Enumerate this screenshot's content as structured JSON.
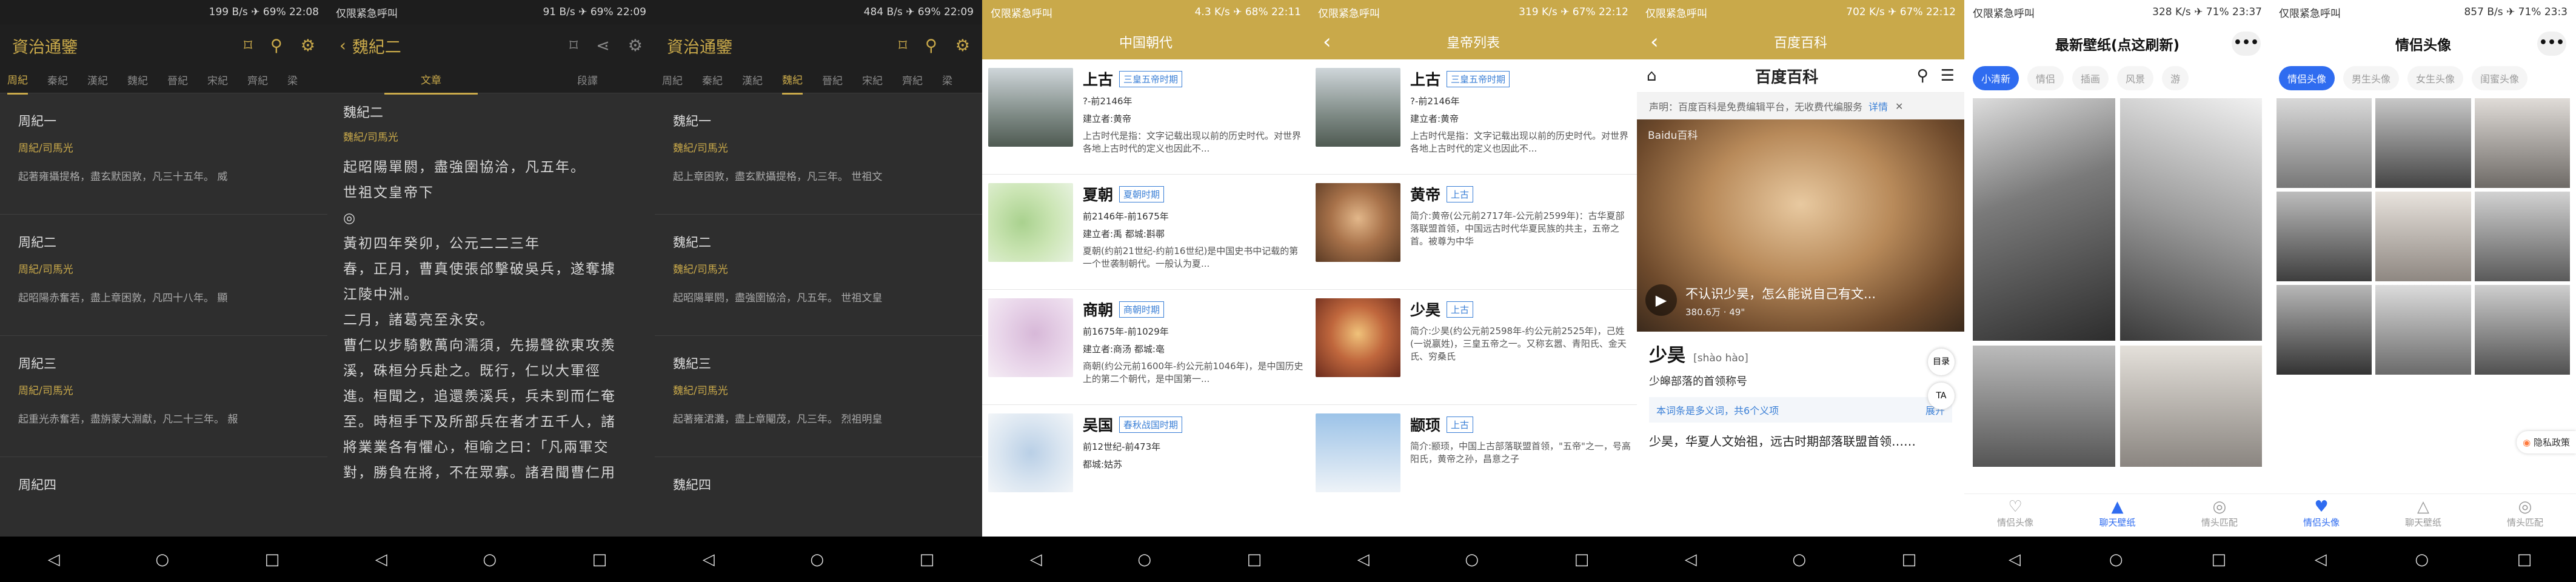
{
  "status": {
    "s1": {
      "left": "",
      "right": "199 B/s ✈ 69% 22:08"
    },
    "s2": {
      "left": "仅限紧急呼叫",
      "right": "91 B/s ✈ 69% 22:09"
    },
    "s3": {
      "left": "",
      "right": "484 B/s ✈ 69% 22:09"
    },
    "s4": {
      "left": "仅限紧急呼叫",
      "right": "4.3 K/s ✈ 68% 22:11"
    },
    "s5": {
      "left": "仅限紧急呼叫",
      "right": "319 K/s ✈ 67% 22:12"
    },
    "s6": {
      "left": "仅限紧急呼叫",
      "right": "702 K/s ✈ 67% 22:12"
    },
    "s7": {
      "left": "仅限紧急呼叫",
      "right": "328 K/s ✈ 71% 23:37"
    },
    "s8": {
      "left": "仅限紧急呼叫",
      "right": "857 B/s ✈ 71% 23:3"
    }
  },
  "reader1": {
    "title": "資治通鑒",
    "tabs": [
      "周紀",
      "秦紀",
      "漢紀",
      "魏紀",
      "晉紀",
      "宋紀",
      "齊紀",
      "梁"
    ],
    "items": [
      {
        "title": "周紀一",
        "author": "周紀/司馬光",
        "summary": "起著雍攝提格，盡玄默困敦，凡三十五年。 威"
      },
      {
        "title": "周紀二",
        "author": "周紀/司馬光",
        "summary": "起昭陽赤奮若，盡上章困敦，凡四十八年。 顯"
      },
      {
        "title": "周紀三",
        "author": "周紀/司馬光",
        "summary": "起重光赤奮若，盡旃蒙大淵獻，凡二十三年。 赧"
      },
      {
        "title": "周紀四",
        "author": "",
        "summary": ""
      }
    ]
  },
  "reader2": {
    "title": "魏紀二",
    "tabs": [
      "文章",
      "段譯"
    ],
    "head": "魏紀二",
    "author": "魏紀/司馬光",
    "lines": [
      "起昭陽單閼，盡強圉協洽，凡五年。",
      "世祖文皇帝下",
      "◎",
      "黃初四年癸卯，公元二二三年",
      "春，正月，曹真使張郃擊破吳兵，遂奪據",
      "江陵中洲。",
      "二月，諸葛亮至永安。",
      "曹仁以步騎數萬向濡須，先揚聲欲東攻羨",
      "溪，硃桓分兵赴之。既行，仁以大軍徑",
      "進。桓聞之，追還羨溪兵，兵未到而仁奄",
      "至。時桓手下及所部兵在者才五千人，諸",
      "將業業各有懼心，桓喻之曰：「凡兩軍交",
      "對，勝負在將，不在眾寡。諸君聞曹仁用"
    ]
  },
  "reader3": {
    "title": "資治通鑒",
    "tabs": [
      "周紀",
      "秦紀",
      "漢紀",
      "魏紀",
      "晉紀",
      "宋紀",
      "齊紀",
      "梁"
    ],
    "items": [
      {
        "title": "魏紀一",
        "author": "魏紀/司馬光",
        "summary": "起上章困敦，盡玄默攝提格，凡三年。 世祖文"
      },
      {
        "title": "魏紀二",
        "author": "魏紀/司馬光",
        "summary": "起昭陽單閼，盡強圉協洽，凡五年。 世祖文皇"
      },
      {
        "title": "魏紀三",
        "author": "魏紀/司馬光",
        "summary": "起著雍涒灘，盡上章閹茂，凡三年。 烈祖明皇"
      },
      {
        "title": "魏紀四",
        "author": "",
        "summary": ""
      }
    ]
  },
  "dynasty": {
    "title": "中国朝代",
    "cards": [
      {
        "name": "上古",
        "tag": "三皇五帝时期",
        "l1": "?-前2146年",
        "l2": "建立者:黄帝",
        "desc": "上古时代是指：文字记载出现以前的历史时代。对世界各地上古时代的定义也因此不..."
      },
      {
        "name": "夏朝",
        "tag": "夏朝时期",
        "l1": "前2146年-前1675年",
        "l2": "建立者:禹 都城:斟鄩",
        "desc": "夏朝(约前21世纪-约前16世纪)是中国史书中记载的第一个世袭制朝代。一般认为夏..."
      },
      {
        "name": "商朝",
        "tag": "商朝时期",
        "l1": "前1675年-前1029年",
        "l2": "建立者:商汤 都城:亳",
        "desc": "商朝(约公元前1600年-约公元前1046年)，是中国历史上的第二个朝代，是中国第一..."
      },
      {
        "name": "吴国",
        "tag": "春秋战国时期",
        "l1": "前12世纪-前473年",
        "l2": "都城:姑苏",
        "desc": ""
      }
    ]
  },
  "emperors": {
    "title": "皇帝列表",
    "cards": [
      {
        "name": "上古",
        "tag": "三皇五帝时期",
        "l1": "?-前2146年",
        "l2": "建立者:黄帝",
        "desc": "上古时代是指：文字记载出现以前的历史时代。对世界各地上古时代的定义也因此不..."
      },
      {
        "name": "黄帝",
        "tag": "上古",
        "l1": "",
        "l2": "",
        "desc": "简介:黄帝(公元前2717年-公元前2599年)：古华夏部落联盟首领，中国远古时代华夏民族的共主，五帝之首。被尊为中华"
      },
      {
        "name": "少昊",
        "tag": "上古",
        "l1": "",
        "l2": "",
        "desc": "简介:少昊(约公元前2598年-约公元前2525年)，己姓(一说嬴姓)，三皇五帝之一。又称玄嚣、青阳氏、金天氏、穷桑氏"
      },
      {
        "name": "颛顼",
        "tag": "上古",
        "l1": "",
        "l2": "",
        "desc": "简介:颛顼，中国上古部落联盟首领，\"五帝\"之一，号高阳氏，黄帝之孙，昌意之子"
      }
    ]
  },
  "baike": {
    "header": "百度百科",
    "logo": "百度百科",
    "notice": "声明：百度百科是免费编辑平台，无收费代编服务",
    "notice_link": "详情",
    "watermark": "Baidu百科",
    "video_caption": "不认识少昊，怎么能说自己有文...",
    "video_stats": "380.6万 · 49\"",
    "name": "少昊",
    "pinyin": "[shào hào]",
    "subtitle": "少皞部落的首领称号",
    "sense_note": "本词条是多义词，共6个义项",
    "sense_link": "展开",
    "body": "少昊，华夏人文始祖，远古时期部落联盟首领……",
    "side_btn1": "目录",
    "side_btn2": "TA"
  },
  "wallpaper": {
    "title": "最新壁纸(点这刷新)",
    "chips": [
      "小清新",
      "情侣",
      "插画",
      "风景",
      "游"
    ],
    "tabs": [
      "情侣头像",
      "聊天壁纸",
      "情头匹配"
    ],
    "more": "•••"
  },
  "avatar": {
    "title": "情侣头像",
    "chips": [
      "情侣头像",
      "男生头像",
      "女生头像",
      "闺蜜头像"
    ],
    "tabs": [
      "情侣头像",
      "聊天壁纸",
      "情头匹配"
    ],
    "privacy": "隐私政策",
    "more": "•••"
  },
  "colors": {
    "gold": "#c9a94a",
    "blue": "#2f6cf0",
    "dark": "#2e2e2e"
  }
}
